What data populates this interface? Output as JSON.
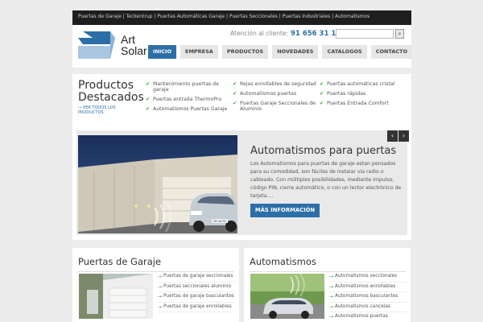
{
  "topbar": {
    "links": "Puertas de Garaje | Teckentrup | Puertas Automáticas Garaje | Puertas Seccionales | Puertas Industriales | Automatismos"
  },
  "header": {
    "logo_line1": "Art",
    "logo_line2": "Solar",
    "contact_label": "Atención al cliente:",
    "phone": "91 656 31 15",
    "search": {
      "placeholder": "",
      "button_icon": "search-icon"
    }
  },
  "nav": {
    "items": [
      "INICIO",
      "EMPRESA",
      "PRODUCTOS",
      "NOVEDADES",
      "CATALOGOS",
      "CONTACTO"
    ]
  },
  "products": {
    "title_line1": "Productos",
    "title_line2": "Destacados",
    "view_all": "→ VER TODOS LOS PRODUCTOS",
    "col1": [
      "Mantenimiento puertas de garaje",
      "Puertas entrada ThermoPro",
      "Automatismos Puertas Garaje"
    ],
    "col2": [
      "Rejas enrollables de seguridad",
      "Automatismos puertas",
      "Puertas Garaje Seccionales de Aluminio"
    ],
    "col3": [
      "Puertas automáticas cristal",
      "Puertas rápidas",
      "Puertas Entrada Comfort"
    ]
  },
  "slider": {
    "title": "Automatismos para puertas",
    "text": "Los Automatismos para puertas de garaje estan pensados para su comodidad, son fáciles de instalar vía radio o cableado. Con múltiples posibilidades, mediante impulso, código PIN, cierre automático, o con un lector electrónico de tarjeta....",
    "button": "MÁS INFORMACIÓN",
    "prev": "‹",
    "next": "›",
    "plate": "FK 14 FS"
  },
  "garaje": {
    "title": "Puertas de Garaje",
    "items": [
      "Puertas de garaje seccionales",
      "Puertas seccionales aluminio",
      "Puertas de garaje basculantes",
      "Puertas de garaje enrollables"
    ]
  },
  "automatismos": {
    "title": "Automatismos",
    "items": [
      "Automatismos seccionales",
      "Automatismos enrollables",
      "Automatismos basculantes",
      "Automatismos cancelas",
      "Automatismos puertas"
    ]
  },
  "colors": {
    "accent": "#2c6fa8",
    "check": "#2ea12e",
    "topbar": "#1e1e1e"
  }
}
